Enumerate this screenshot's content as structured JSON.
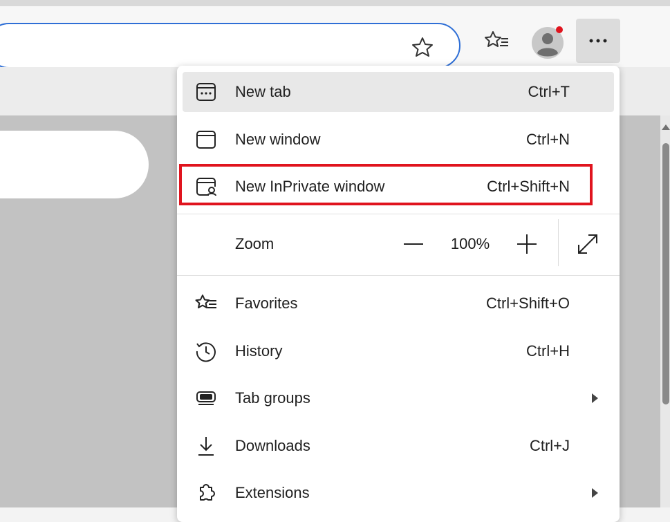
{
  "menu": {
    "items_top": [
      {
        "label": "New tab",
        "shortcut": "Ctrl+T",
        "icon": "new-tab-icon"
      },
      {
        "label": "New window",
        "shortcut": "Ctrl+N",
        "icon": "new-window-icon"
      },
      {
        "label": "New InPrivate window",
        "shortcut": "Ctrl+Shift+N",
        "icon": "inprivate-icon"
      }
    ],
    "zoom": {
      "label": "Zoom",
      "value": "100%"
    },
    "items_bottom": [
      {
        "label": "Favorites",
        "shortcut": "Ctrl+Shift+O",
        "icon": "favorites-icon"
      },
      {
        "label": "History",
        "shortcut": "Ctrl+H",
        "icon": "history-icon"
      },
      {
        "label": "Tab groups",
        "shortcut": "",
        "icon": "tab-groups-icon"
      },
      {
        "label": "Downloads",
        "shortcut": "Ctrl+J",
        "icon": "download-icon"
      },
      {
        "label": "Extensions",
        "shortcut": "",
        "icon": "extensions-icon"
      }
    ]
  },
  "colors": {
    "accent": "#2f6fd6",
    "highlight_box": "#e0141e",
    "notification_dot": "#e0141e"
  }
}
